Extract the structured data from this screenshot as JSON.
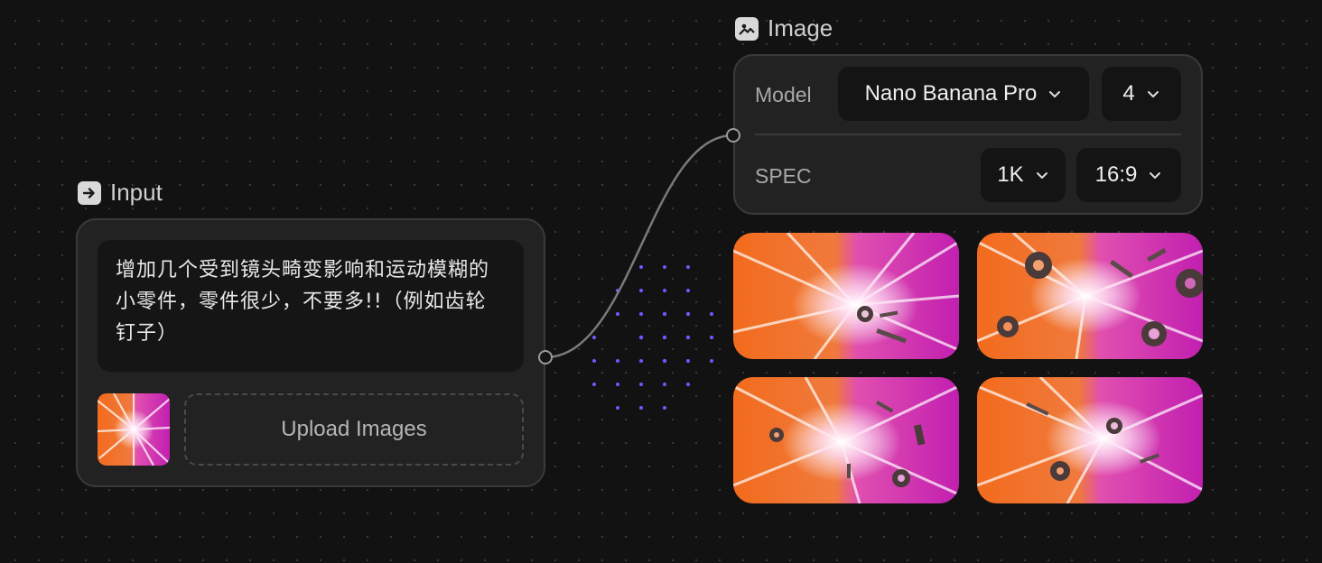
{
  "input_node": {
    "title": "Input",
    "prompt_text": "增加几个受到镜头畸变影响和运动模糊的小零件，零件很少，不要多!!（例如齿轮钉子）",
    "upload_label": "Upload Images"
  },
  "image_node": {
    "title": "Image",
    "model_label": "Model",
    "model_value": "Nano Banana Pro",
    "count_value": "4",
    "spec_label": "SPEC",
    "resolution_value": "1K",
    "aspect_value": "16:9"
  },
  "icons": {
    "input": "arrow-right-square-icon",
    "image": "image-icon",
    "dropdown": "chevron-down-icon"
  },
  "colors": {
    "background": "#121212",
    "node": "#222222",
    "accent_dots": "#6b5bff",
    "image_orange": "#f26b1d",
    "image_magenta": "#c21fb0"
  }
}
